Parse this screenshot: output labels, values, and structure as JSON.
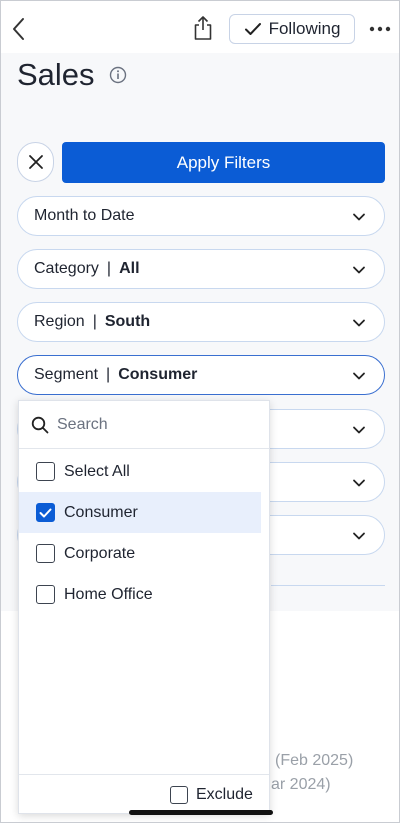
{
  "header": {
    "back_icon": "chevron-left-icon",
    "share_icon": "share-icon",
    "following_label": "Following",
    "following_icon": "check-icon",
    "more_icon": "more-horizontal-icon"
  },
  "page": {
    "title": "Sales",
    "info_icon": "info-icon"
  },
  "filters": {
    "close_icon": "close-icon",
    "apply_label": "Apply Filters",
    "pills": [
      {
        "label": "Month to Date",
        "value": ""
      },
      {
        "label": "Category",
        "value": "All"
      },
      {
        "label": "Region",
        "value": "South"
      },
      {
        "label": "Segment",
        "value": "Consumer"
      }
    ],
    "separator": "|"
  },
  "dropdown": {
    "search_placeholder": "Search",
    "items": [
      {
        "label": "Select All",
        "checked": false
      },
      {
        "label": "Consumer",
        "checked": true
      },
      {
        "label": "Corporate",
        "checked": false
      },
      {
        "label": "Home Office",
        "checked": false
      }
    ],
    "exclude_label": "Exclude",
    "exclude_checked": false
  },
  "background": {
    "line1": "(Feb 2025)",
    "line2": "ar 2024)"
  },
  "colors": {
    "accent": "#0b5cd5",
    "selected_bg": "#e8effc"
  }
}
